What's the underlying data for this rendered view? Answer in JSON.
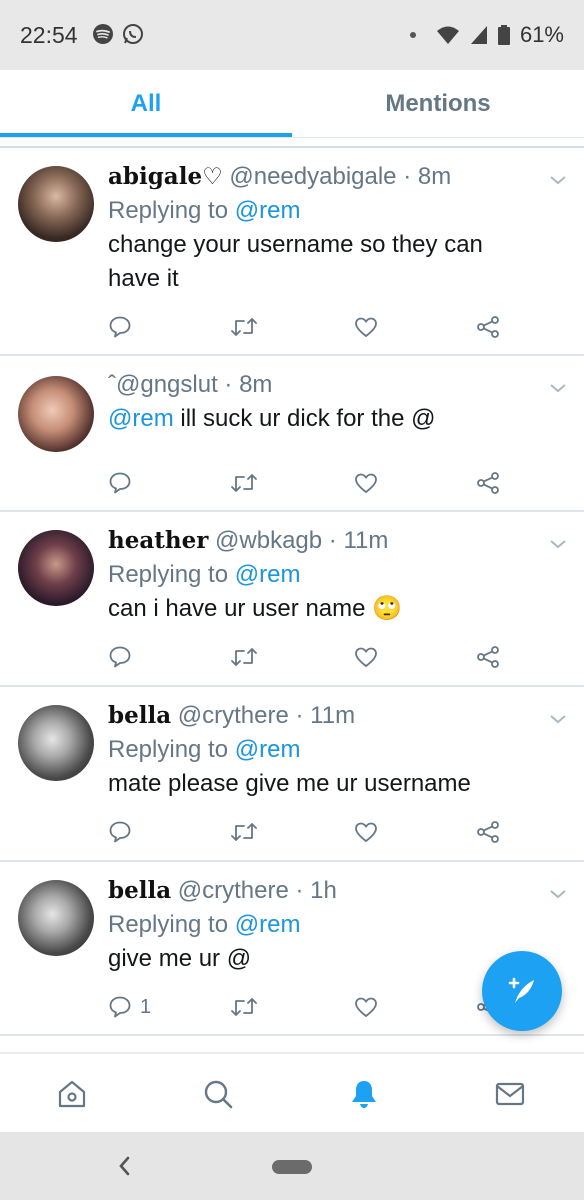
{
  "status": {
    "time": "22:54",
    "battery": "61%"
  },
  "tabs": {
    "all": "All",
    "mentions": "Mentions"
  },
  "tweets": [
    {
      "name": "abigale♡",
      "handle": "@needyabigale",
      "time": "8m",
      "replying_prefix": "Replying to",
      "replying_to": "@rem",
      "text": "change your username so they can have it",
      "reply_count": ""
    },
    {
      "name": "",
      "handle": "ˆ@gngslut",
      "time": "8m",
      "mention": "@rem",
      "text": " ill suck ur dick for the @",
      "reply_count": ""
    },
    {
      "name": "heather",
      "handle": "@wbkagb",
      "time": "11m",
      "replying_prefix": "Replying to",
      "replying_to": "@rem",
      "text": "can i have ur user name",
      "emoji": "🙄",
      "reply_count": ""
    },
    {
      "name": "bella",
      "handle": "@crythere",
      "time": "11m",
      "replying_prefix": "Replying to",
      "replying_to": "@rem",
      "text": "mate please give me ur username",
      "reply_count": ""
    },
    {
      "name": "bella",
      "handle": "@crythere",
      "time": "1h",
      "replying_prefix": "Replying to",
      "replying_to": "@rem",
      "text": "give me ur @",
      "reply_count": "1"
    }
  ],
  "icons": {
    "reply": "reply-icon",
    "retweet": "retweet-icon",
    "like": "like-icon",
    "share": "share-icon",
    "home": "home-icon",
    "search": "search-icon",
    "notifications": "bell-icon",
    "messages": "mail-icon",
    "compose": "compose-icon",
    "more": "chevron-down-icon"
  },
  "colors": {
    "accent": "#1da1f2",
    "link": "#1b95e0",
    "muted": "#657786"
  }
}
